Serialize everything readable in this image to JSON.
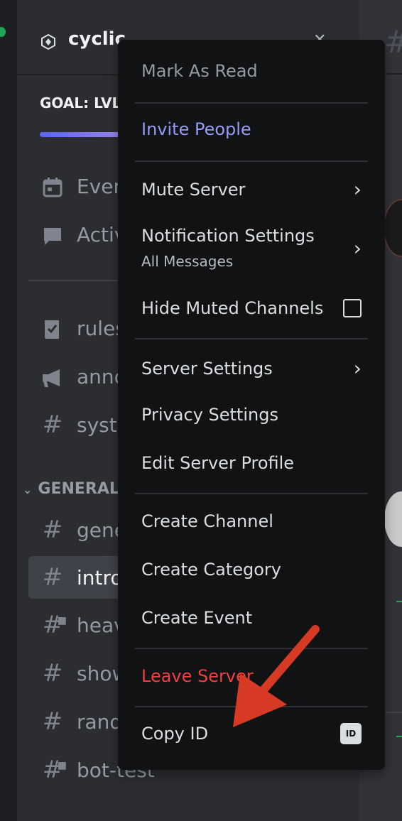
{
  "server": {
    "name": "cyclic",
    "goal_label": "GOAL: LVL"
  },
  "channels_top": [
    {
      "label": "Events",
      "icon": "calendar-icon"
    },
    {
      "label": "Activity",
      "icon": "chat-bubble-icon"
    }
  ],
  "channels": [
    {
      "label": "rules",
      "icon": "rules-icon"
    },
    {
      "label": "announcements",
      "icon": "megaphone-icon"
    },
    {
      "label": "system",
      "icon": "hash-icon"
    }
  ],
  "category": {
    "label": "GENERAL"
  },
  "general_channels": [
    {
      "label": "general",
      "icon": "hash-icon"
    },
    {
      "label": "intro",
      "icon": "hash-icon"
    },
    {
      "label": "heav",
      "icon": "locked-hash-icon"
    },
    {
      "label": "show",
      "icon": "hash-icon"
    },
    {
      "label": "rand",
      "icon": "hash-icon"
    },
    {
      "label": "bot-test",
      "icon": "locked-hash-icon"
    }
  ],
  "menu": {
    "mark_as_read": "Mark As Read",
    "invite_people": "Invite People",
    "mute_server": "Mute Server",
    "notification_settings": "Notification Settings",
    "notification_settings_value": "All Messages",
    "hide_muted_channels": "Hide Muted Channels",
    "server_settings": "Server Settings",
    "privacy_settings": "Privacy Settings",
    "edit_server_profile": "Edit Server Profile",
    "create_channel": "Create Channel",
    "create_category": "Create Category",
    "create_event": "Create Event",
    "leave_server": "Leave Server",
    "copy_id": "Copy ID",
    "id_badge": "ID"
  },
  "colors": {
    "brand": "#949cf7",
    "danger": "#f23f43",
    "annotation_arrow": "#d63a24"
  }
}
